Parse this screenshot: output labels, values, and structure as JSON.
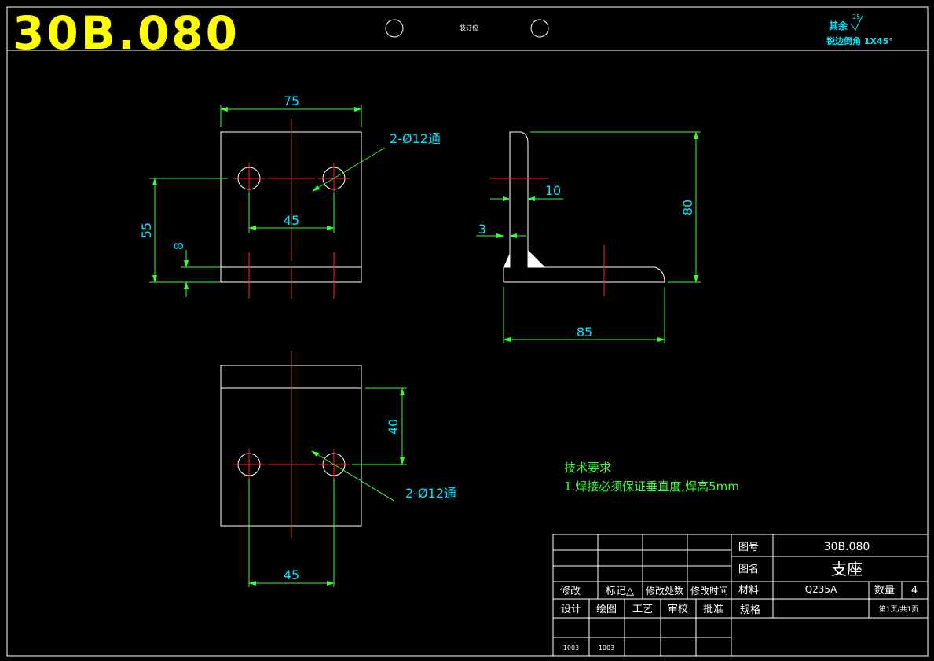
{
  "header": {
    "drawing_code": "30B.080",
    "binding_label": "装订位",
    "roughness_label": "其余",
    "roughness_value": "25",
    "chamfer_note": "锐边倒角 1X45°"
  },
  "views": {
    "front": {
      "width_dim": "75",
      "hole_spacing_dim": "45",
      "height_dim": "55",
      "small_dim": "8",
      "hole_callout": "2-Ø12通"
    },
    "side": {
      "dim_10": "10",
      "dim_3": "3",
      "dim_80": "80",
      "dim_85": "85"
    },
    "top": {
      "dim_40": "40",
      "hole_spacing_dim": "45",
      "hole_callout": "2-Ø12通"
    }
  },
  "tech_requirements": {
    "title": "技术要求",
    "item1": "1.焊接必须保证垂直度,焊高5mm"
  },
  "title_block": {
    "drawing_no_label": "图号",
    "drawing_no": "30B.080",
    "name_label": "图名",
    "name": "支座",
    "material_label": "材料",
    "material": "Q235A",
    "qty_label": "数量",
    "qty": "4",
    "spec_label": "规格",
    "page_info": "第1页/共1页",
    "rev_headers": [
      "修改",
      "标记△",
      "修改处数",
      "修改时间"
    ],
    "sign_headers": [
      "设计",
      "绘图",
      "工艺",
      "审校",
      "批准"
    ],
    "design_date": "1003",
    "draw_date": "1003"
  },
  "colors": {
    "outline": "#ffffff",
    "center_line": "#ff2222",
    "dimension": "#33ff33",
    "dim_text": "#00e5ff",
    "code_text": "#ffff00"
  }
}
